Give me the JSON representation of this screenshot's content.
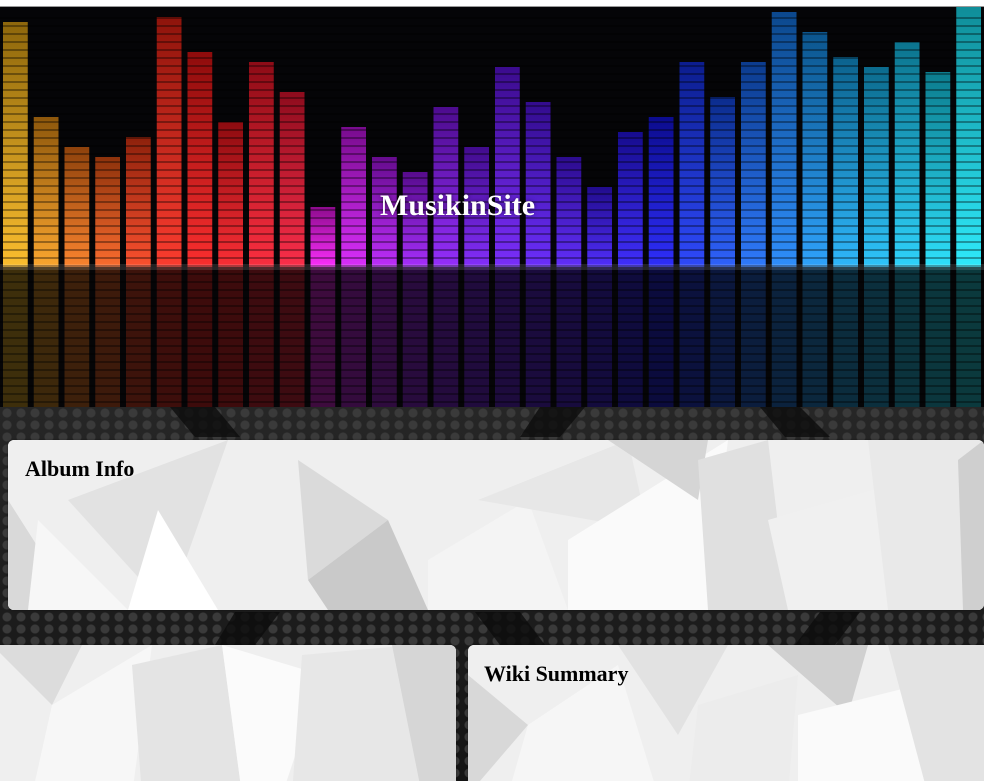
{
  "header": {
    "site_title": "MusikinSite"
  },
  "panels": {
    "album_info_title": "Album Info",
    "wiki_summary_title": "Wiki Summary"
  },
  "colors": {
    "header_bg": "#050507",
    "panel_bg": "#f1f1f1",
    "page_bg": "#1b1b1b"
  }
}
